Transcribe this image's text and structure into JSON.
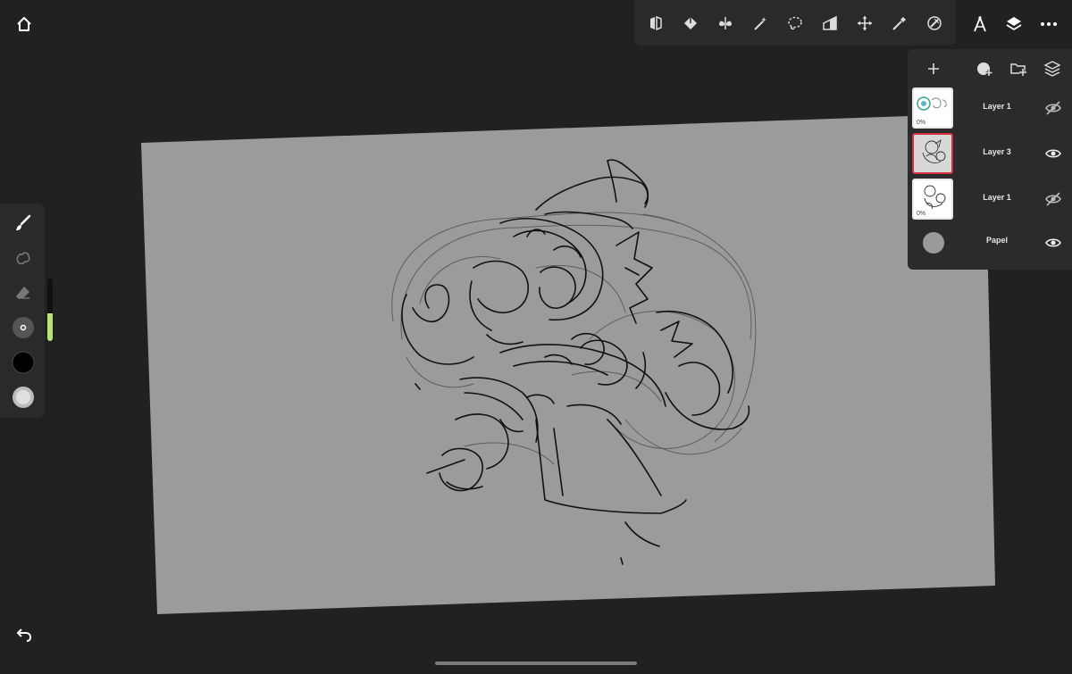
{
  "colors": {
    "background": "#212121",
    "panel": "#2b2b2b",
    "canvas": "#9b9b9b",
    "stroke": "#111111",
    "accent_selected": "#d0303f",
    "size_slider": "#b8e57a"
  },
  "top_toolbar": {
    "icons": [
      "mirror-icon",
      "fill-icon",
      "symmetry-icon",
      "magic-wand-icon",
      "lasso-select-icon",
      "perspective-icon",
      "move-icon",
      "eyedropper-icon",
      "brush-library-icon"
    ]
  },
  "top_right": {
    "icons": [
      "ruler-icon",
      "layers-icon",
      "more-icon"
    ]
  },
  "left_toolbar": {
    "tools": [
      "brush-icon",
      "smudge-icon",
      "eraser-icon",
      "brush-size-icon",
      "primary-color-swatch",
      "secondary-color-swatch"
    ],
    "brush_size_level": 0.45
  },
  "layers_panel": {
    "header_icons": [
      "add-layer-icon",
      "add-group-icon",
      "add-folder-icon",
      "layer-options-icon"
    ],
    "layers": [
      {
        "name": "Layer 1",
        "opacity": "0%",
        "visible": false,
        "selected": false
      },
      {
        "name": "Layer 3",
        "opacity": "",
        "visible": true,
        "selected": true
      },
      {
        "name": "Layer 1",
        "opacity": "0%",
        "visible": false,
        "selected": false
      },
      {
        "name": "Papel",
        "opacity": "",
        "visible": true,
        "selected": false,
        "is_paper": true
      }
    ]
  }
}
